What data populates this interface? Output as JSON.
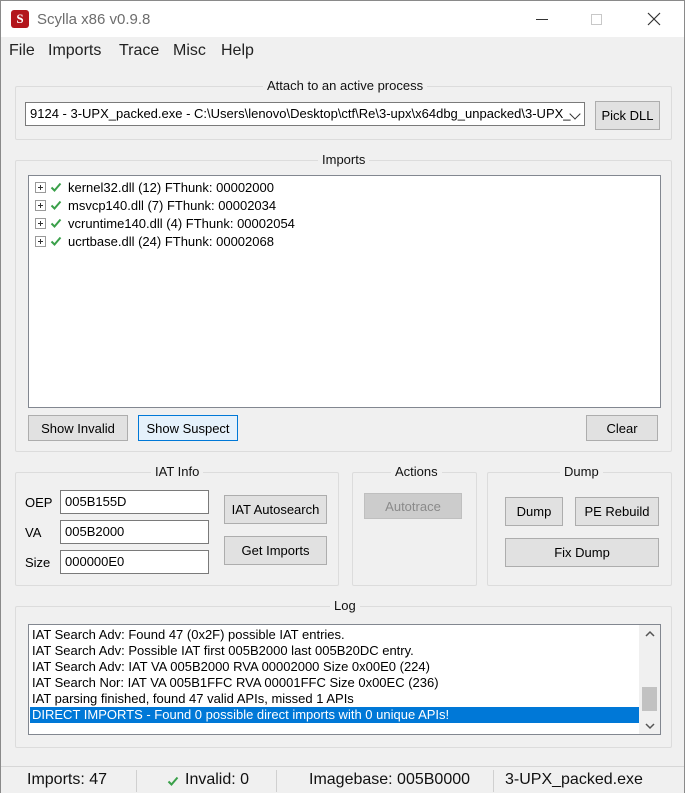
{
  "window": {
    "title": "Scylla x86 v0.9.8",
    "icon_letter": "S",
    "icon": "app-logo-icon",
    "controls": [
      "minimize-icon",
      "maximize-icon",
      "close-icon"
    ]
  },
  "menu": [
    "File",
    "Imports",
    "Trace",
    "Misc",
    "Help"
  ],
  "attach": {
    "label": "Attach to an active process",
    "process": "9124 - 3-UPX_packed.exe - C:\\Users\\lenovo\\Desktop\\ctf\\Re\\3-upx\\x64dbg_unpacked\\3-UPX_",
    "pick_dll": "Pick DLL"
  },
  "imports": {
    "label": "Imports",
    "items": [
      {
        "text": "kernel32.dll (12) FThunk: 00002000"
      },
      {
        "text": "msvcp140.dll (7) FThunk: 00002034"
      },
      {
        "text": "vcruntime140.dll (4) FThunk: 00002054"
      },
      {
        "text": "ucrtbase.dll (24) FThunk: 00002068"
      }
    ],
    "show_invalid": "Show Invalid",
    "show_suspect": "Show Suspect",
    "clear": "Clear"
  },
  "iat_info": {
    "label": "IAT Info",
    "oep_label": "OEP",
    "oep_value": "005B155D",
    "va_label": "VA",
    "va_value": "005B2000",
    "size_label": "Size",
    "size_value": "000000E0",
    "iat_autosearch": "IAT Autosearch",
    "get_imports": "Get Imports"
  },
  "actions": {
    "label": "Actions",
    "autotrace": "Autotrace"
  },
  "dump": {
    "label": "Dump",
    "dump": "Dump",
    "pe_rebuild": "PE Rebuild",
    "fix_dump": "Fix Dump"
  },
  "log": {
    "label": "Log",
    "lines": [
      "IAT Search Adv: Found 47 (0x2F) possible IAT entries.",
      "IAT Search Adv: Possible IAT first 005B2000 last 005B20DC entry.",
      "IAT Search Adv: IAT VA 005B2000 RVA 00002000 Size 0x00E0 (224)",
      "IAT Search Nor: IAT VA 005B1FFC RVA 00001FFC Size 0x00EC (236)",
      "IAT parsing finished, found 47 valid APIs, missed 1 APIs",
      "DIRECT IMPORTS - Found 0 possible direct imports with 0 unique APIs!"
    ]
  },
  "status": {
    "imports": "Imports: 47",
    "invalid": "Invalid: 0",
    "imagebase": "Imagebase: 005B0000",
    "module": "3-UPX_packed.exe"
  },
  "colors": {
    "accent": "#0078d7",
    "check_green": "#3aa04a",
    "icon_red": "#b3161c"
  }
}
